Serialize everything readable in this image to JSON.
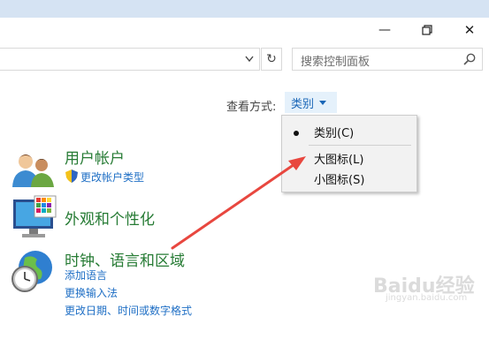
{
  "window": {
    "minimize_glyph": "—",
    "close_glyph": "✕"
  },
  "address_bar": {
    "refresh_glyph": "↻"
  },
  "search": {
    "placeholder": "搜索控制面板"
  },
  "view_by": {
    "label": "查看方式:",
    "value": "类别",
    "menu": {
      "items": [
        {
          "label": "类别(C)",
          "selected": true
        },
        {
          "label": "大图标(L)",
          "selected": false
        },
        {
          "label": "小图标(S)",
          "selected": false
        }
      ]
    }
  },
  "categories": [
    {
      "title": "用户帐户",
      "icon": "users-icon",
      "links": [
        "更改帐户类型"
      ]
    },
    {
      "title": "外观和个性化",
      "icon": "appearance-monitor-icon",
      "links": []
    },
    {
      "title": "时钟、语言和区域",
      "icon": "clock-globe-icon",
      "links": [
        "添加语言",
        "更换输入法",
        "更改日期、时间或数字格式"
      ]
    }
  ],
  "watermark": {
    "text": "Baidu经验",
    "url_text": "jingyan.baidu.com"
  },
  "colors": {
    "category_title": "#267b34",
    "link": "#1f6fc5",
    "annotation_arrow": "#e8473f"
  }
}
